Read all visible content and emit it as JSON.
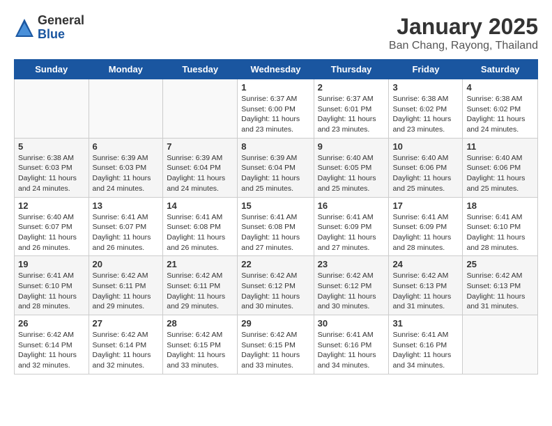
{
  "header": {
    "logo_general": "General",
    "logo_blue": "Blue",
    "title": "January 2025",
    "subtitle": "Ban Chang, Rayong, Thailand"
  },
  "weekdays": [
    "Sunday",
    "Monday",
    "Tuesday",
    "Wednesday",
    "Thursday",
    "Friday",
    "Saturday"
  ],
  "weeks": [
    [
      {
        "day": "",
        "info": ""
      },
      {
        "day": "",
        "info": ""
      },
      {
        "day": "",
        "info": ""
      },
      {
        "day": "1",
        "info": "Sunrise: 6:37 AM\nSunset: 6:00 PM\nDaylight: 11 hours\nand 23 minutes."
      },
      {
        "day": "2",
        "info": "Sunrise: 6:37 AM\nSunset: 6:01 PM\nDaylight: 11 hours\nand 23 minutes."
      },
      {
        "day": "3",
        "info": "Sunrise: 6:38 AM\nSunset: 6:02 PM\nDaylight: 11 hours\nand 23 minutes."
      },
      {
        "day": "4",
        "info": "Sunrise: 6:38 AM\nSunset: 6:02 PM\nDaylight: 11 hours\nand 24 minutes."
      }
    ],
    [
      {
        "day": "5",
        "info": "Sunrise: 6:38 AM\nSunset: 6:03 PM\nDaylight: 11 hours\nand 24 minutes."
      },
      {
        "day": "6",
        "info": "Sunrise: 6:39 AM\nSunset: 6:03 PM\nDaylight: 11 hours\nand 24 minutes."
      },
      {
        "day": "7",
        "info": "Sunrise: 6:39 AM\nSunset: 6:04 PM\nDaylight: 11 hours\nand 24 minutes."
      },
      {
        "day": "8",
        "info": "Sunrise: 6:39 AM\nSunset: 6:04 PM\nDaylight: 11 hours\nand 25 minutes."
      },
      {
        "day": "9",
        "info": "Sunrise: 6:40 AM\nSunset: 6:05 PM\nDaylight: 11 hours\nand 25 minutes."
      },
      {
        "day": "10",
        "info": "Sunrise: 6:40 AM\nSunset: 6:06 PM\nDaylight: 11 hours\nand 25 minutes."
      },
      {
        "day": "11",
        "info": "Sunrise: 6:40 AM\nSunset: 6:06 PM\nDaylight: 11 hours\nand 25 minutes."
      }
    ],
    [
      {
        "day": "12",
        "info": "Sunrise: 6:40 AM\nSunset: 6:07 PM\nDaylight: 11 hours\nand 26 minutes."
      },
      {
        "day": "13",
        "info": "Sunrise: 6:41 AM\nSunset: 6:07 PM\nDaylight: 11 hours\nand 26 minutes."
      },
      {
        "day": "14",
        "info": "Sunrise: 6:41 AM\nSunset: 6:08 PM\nDaylight: 11 hours\nand 26 minutes."
      },
      {
        "day": "15",
        "info": "Sunrise: 6:41 AM\nSunset: 6:08 PM\nDaylight: 11 hours\nand 27 minutes."
      },
      {
        "day": "16",
        "info": "Sunrise: 6:41 AM\nSunset: 6:09 PM\nDaylight: 11 hours\nand 27 minutes."
      },
      {
        "day": "17",
        "info": "Sunrise: 6:41 AM\nSunset: 6:09 PM\nDaylight: 11 hours\nand 28 minutes."
      },
      {
        "day": "18",
        "info": "Sunrise: 6:41 AM\nSunset: 6:10 PM\nDaylight: 11 hours\nand 28 minutes."
      }
    ],
    [
      {
        "day": "19",
        "info": "Sunrise: 6:41 AM\nSunset: 6:10 PM\nDaylight: 11 hours\nand 28 minutes."
      },
      {
        "day": "20",
        "info": "Sunrise: 6:42 AM\nSunset: 6:11 PM\nDaylight: 11 hours\nand 29 minutes."
      },
      {
        "day": "21",
        "info": "Sunrise: 6:42 AM\nSunset: 6:11 PM\nDaylight: 11 hours\nand 29 minutes."
      },
      {
        "day": "22",
        "info": "Sunrise: 6:42 AM\nSunset: 6:12 PM\nDaylight: 11 hours\nand 30 minutes."
      },
      {
        "day": "23",
        "info": "Sunrise: 6:42 AM\nSunset: 6:12 PM\nDaylight: 11 hours\nand 30 minutes."
      },
      {
        "day": "24",
        "info": "Sunrise: 6:42 AM\nSunset: 6:13 PM\nDaylight: 11 hours\nand 31 minutes."
      },
      {
        "day": "25",
        "info": "Sunrise: 6:42 AM\nSunset: 6:13 PM\nDaylight: 11 hours\nand 31 minutes."
      }
    ],
    [
      {
        "day": "26",
        "info": "Sunrise: 6:42 AM\nSunset: 6:14 PM\nDaylight: 11 hours\nand 32 minutes."
      },
      {
        "day": "27",
        "info": "Sunrise: 6:42 AM\nSunset: 6:14 PM\nDaylight: 11 hours\nand 32 minutes."
      },
      {
        "day": "28",
        "info": "Sunrise: 6:42 AM\nSunset: 6:15 PM\nDaylight: 11 hours\nand 33 minutes."
      },
      {
        "day": "29",
        "info": "Sunrise: 6:42 AM\nSunset: 6:15 PM\nDaylight: 11 hours\nand 33 minutes."
      },
      {
        "day": "30",
        "info": "Sunrise: 6:41 AM\nSunset: 6:16 PM\nDaylight: 11 hours\nand 34 minutes."
      },
      {
        "day": "31",
        "info": "Sunrise: 6:41 AM\nSunset: 6:16 PM\nDaylight: 11 hours\nand 34 minutes."
      },
      {
        "day": "",
        "info": ""
      }
    ]
  ]
}
